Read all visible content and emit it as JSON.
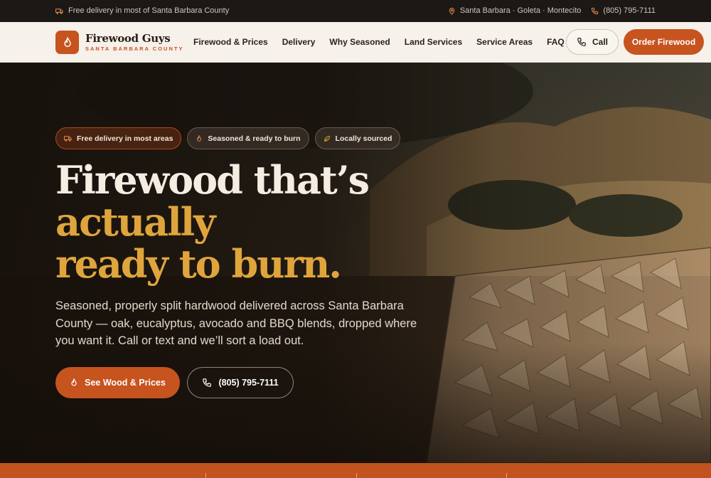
{
  "topbar": {
    "delivery_text": "Free delivery in most of Santa Barbara County",
    "locations": "Santa Barbara · Goleta · Montecito",
    "phone": "(805) 795-7111"
  },
  "brand": {
    "name": "Firewood Guys",
    "tagline": "SANTA BARBARA COUNTY",
    "accent": "#c7531f",
    "gold": "#dfa53c"
  },
  "nav": {
    "items": [
      "Firewood & Prices",
      "Delivery",
      "Why Seasoned",
      "Land Services",
      "Service Areas",
      "FAQ"
    ],
    "call_label": "Call",
    "order_label": "Order Firewood"
  },
  "hero": {
    "pills": [
      "Free delivery in most areas",
      "Seasoned & ready to burn",
      "Locally sourced"
    ],
    "headline_line1": "Firewood that’s",
    "headline_line2": "actually",
    "headline_line3": "ready to burn.",
    "description": "Seasoned, properly split hardwood delivered across Santa Barbara County — oak, eucalyptus, avocado and BBQ blends, dropped where you want it. Call or text and we’ll sort a load out.",
    "cta_primary": "See Wood & Prices",
    "cta_secondary": "(805) 795-7111"
  },
  "icons": {
    "truck": "truck-icon",
    "pin": "map-pin-icon",
    "phone": "phone-icon",
    "flame": "flame-icon",
    "leaf": "leaf-icon"
  }
}
